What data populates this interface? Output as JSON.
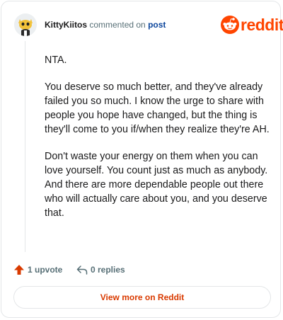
{
  "header": {
    "username": "KittyKiitos",
    "verb": "commented on",
    "post_link": "post",
    "brand": "reddit"
  },
  "comment": {
    "paragraphs": [
      "NTA.",
      "You deserve so much better, and they've already failed you so much. I know the urge to share with people you hope have changed, but the thing is they'll come to you if/when they realize they're AH.",
      "Don't waste your energy on them when you can love yourself. You count just as much as anybody. And there are more dependable people out there who will actually care about you, and you deserve that."
    ]
  },
  "actions": {
    "upvote_label": "1 upvote",
    "reply_label": "0 replies"
  },
  "footer": {
    "view_more_label": "View more on Reddit"
  },
  "colors": {
    "brand": "#ff4500",
    "upvote": "#d93a00",
    "link": "#0a449b",
    "muted": "#576f76"
  }
}
